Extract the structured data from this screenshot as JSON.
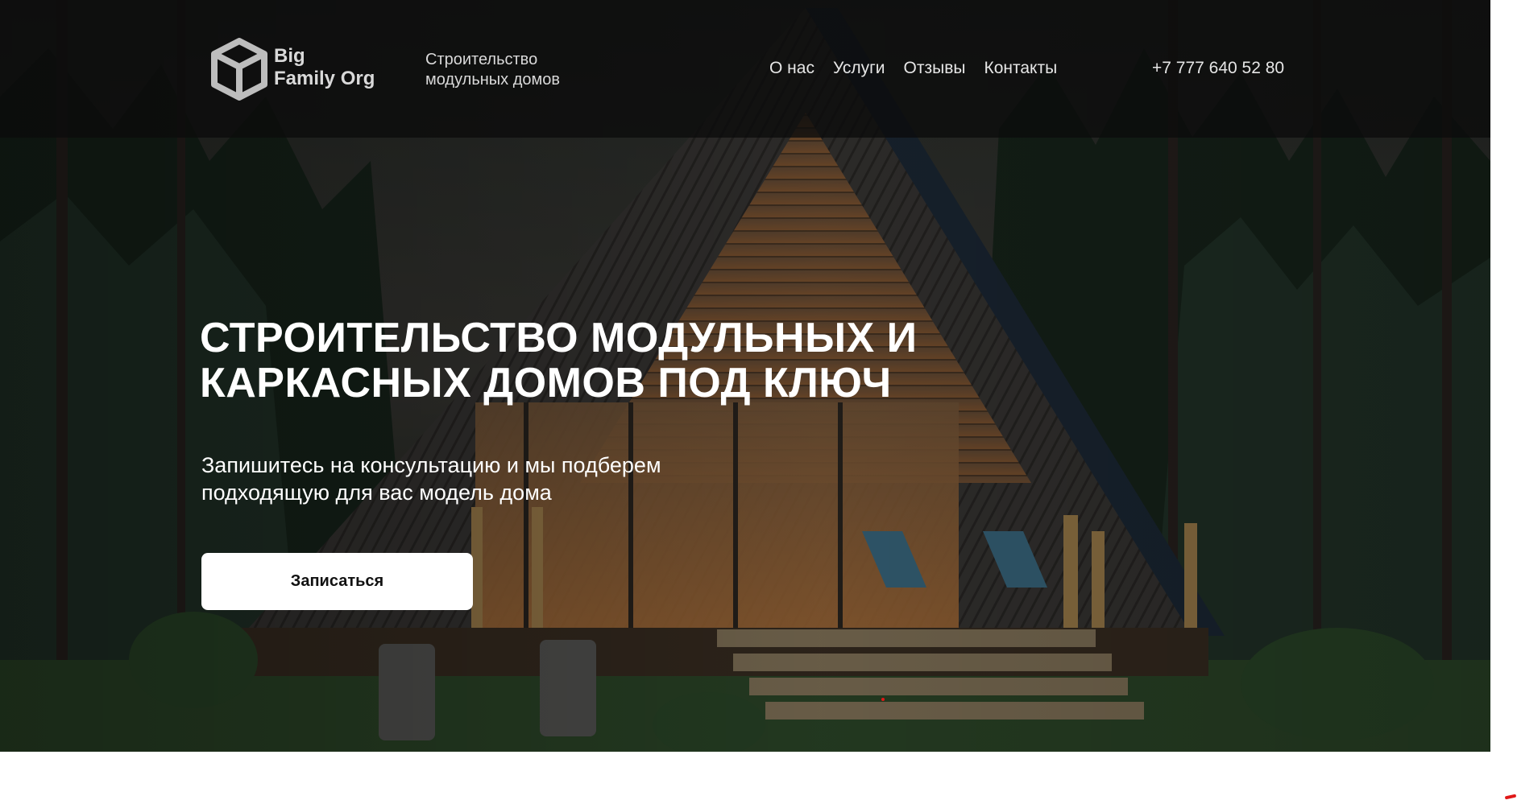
{
  "header": {
    "brand_line1": "Big",
    "brand_line2": "Family Org",
    "tagline_line1": "Строительство",
    "tagline_line2": "модульных домов",
    "nav": [
      {
        "label": "О нас"
      },
      {
        "label": "Услуги"
      },
      {
        "label": "Отзывы"
      },
      {
        "label": "Контакты"
      }
    ],
    "phone": "+7 777 640 52 80"
  },
  "hero": {
    "title_line1": "СТРОИТЕЛЬСТВО МОДУЛЬНЫХ И",
    "title_line2": "КАРКАСНЫХ ДОМОВ ПОД КЛЮЧ",
    "subtitle_line1": "Запишитесь на консультацию и мы подберем",
    "subtitle_line2": "подходящую для вас модель дома",
    "cta_label": "Записаться"
  },
  "colors": {
    "header_bg": "#0c0c0c",
    "text": "#ffffff",
    "cta_bg": "#ffffff",
    "accent_dot": "#e01818"
  }
}
